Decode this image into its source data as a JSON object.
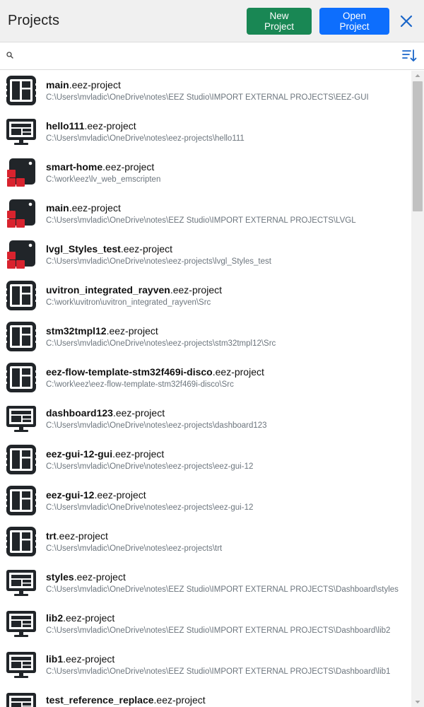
{
  "header": {
    "title": "Projects",
    "new_project_label": "New Project",
    "open_project_label": "Open Project",
    "close_icon": "close-icon"
  },
  "search": {
    "placeholder": "",
    "value": "",
    "search_icon": "search-icon",
    "sort_icon": "sort-ascending-icon"
  },
  "colors": {
    "new_button": "#198754",
    "open_button": "#0d6efd",
    "close_icon": "#1a66c9",
    "icon_dark": "#212529",
    "icon_red": "#d9232e"
  },
  "projects": [
    {
      "name": "main",
      "ext": ".eez-project",
      "path": "C:\\Users\\mvladic\\OneDrive\\notes\\EEZ Studio\\IMPORT EXTERNAL PROJECTS\\EEZ-GUI",
      "icon": "chip-icon"
    },
    {
      "name": "hello111",
      "ext": ".eez-project",
      "path": "C:\\Users\\mvladic\\OneDrive\\notes\\eez-projects\\hello111",
      "icon": "monitor-icon"
    },
    {
      "name": "smart-home",
      "ext": ".eez-project",
      "path": "C:\\work\\eez\\lv_web_emscripten",
      "icon": "lvgl-icon"
    },
    {
      "name": "main",
      "ext": ".eez-project",
      "path": "C:\\Users\\mvladic\\OneDrive\\notes\\EEZ Studio\\IMPORT EXTERNAL PROJECTS\\LVGL",
      "icon": "lvgl-icon"
    },
    {
      "name": "lvgl_Styles_test",
      "ext": ".eez-project",
      "path": "C:\\Users\\mvladic\\OneDrive\\notes\\eez-projects\\lvgl_Styles_test",
      "icon": "lvgl-icon"
    },
    {
      "name": "uvitron_integrated_rayven",
      "ext": ".eez-project",
      "path": "C:\\work\\uvitron\\uvitron_integrated_rayven\\Src",
      "icon": "chip-icon"
    },
    {
      "name": "stm32tmpl12",
      "ext": ".eez-project",
      "path": "C:\\Users\\mvladic\\OneDrive\\notes\\eez-projects\\stm32tmpl12\\Src",
      "icon": "chip-icon"
    },
    {
      "name": "eez-flow-template-stm32f469i-disco",
      "ext": ".eez-project",
      "path": "C:\\work\\eez\\eez-flow-template-stm32f469i-disco\\Src",
      "icon": "chip-icon"
    },
    {
      "name": "dashboard123",
      "ext": ".eez-project",
      "path": "C:\\Users\\mvladic\\OneDrive\\notes\\eez-projects\\dashboard123",
      "icon": "monitor-icon"
    },
    {
      "name": "eez-gui-12-gui",
      "ext": ".eez-project",
      "path": "C:\\Users\\mvladic\\OneDrive\\notes\\eez-projects\\eez-gui-12",
      "icon": "chip-icon"
    },
    {
      "name": "eez-gui-12",
      "ext": ".eez-project",
      "path": "C:\\Users\\mvladic\\OneDrive\\notes\\eez-projects\\eez-gui-12",
      "icon": "chip-icon"
    },
    {
      "name": "trt",
      "ext": ".eez-project",
      "path": "C:\\Users\\mvladic\\OneDrive\\notes\\eez-projects\\trt",
      "icon": "chip-icon"
    },
    {
      "name": "styles",
      "ext": ".eez-project",
      "path": "C:\\Users\\mvladic\\OneDrive\\notes\\EEZ Studio\\IMPORT EXTERNAL PROJECTS\\Dashboard\\styles",
      "icon": "monitor-icon"
    },
    {
      "name": "lib2",
      "ext": ".eez-project",
      "path": "C:\\Users\\mvladic\\OneDrive\\notes\\EEZ Studio\\IMPORT EXTERNAL PROJECTS\\Dashboard\\lib2",
      "icon": "monitor-icon"
    },
    {
      "name": "lib1",
      "ext": ".eez-project",
      "path": "C:\\Users\\mvladic\\OneDrive\\notes\\EEZ Studio\\IMPORT EXTERNAL PROJECTS\\Dashboard\\lib1",
      "icon": "monitor-icon"
    },
    {
      "name": "test_reference_replace",
      "ext": ".eez-project",
      "path": "",
      "icon": "monitor-icon"
    }
  ]
}
